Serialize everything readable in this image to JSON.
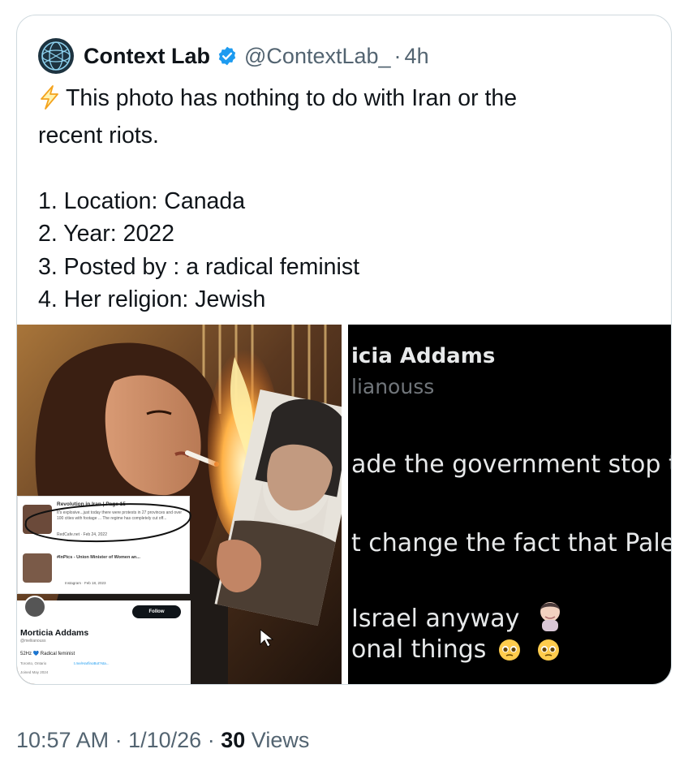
{
  "author": {
    "display_name": "Context Lab",
    "handle": "@ContextLab_",
    "separator": "·",
    "time_ago": "4h",
    "verified": true,
    "avatar_icon": "globe-logo-icon"
  },
  "tweet": {
    "lines": [
      "This photo has nothing to do with Iran or the",
      "recent riots.",
      "",
      "1. Location:  Canada",
      "2. Year:   2022",
      "3. Posted by :  a radical feminist",
      "4. Her religion:  Jewish"
    ],
    "lead_icon": "lightning-bolt-icon"
  },
  "media": {
    "left_inset_list": {
      "item1_title": "Revolution in Iran | Page 15",
      "item1_text": "It's explosive...just today there were protests in 27 provinces and over 100 cities with footage ... The regime has completely cut off...",
      "item1_source": "RedCafe.net · Feb 24, 2022",
      "item2_title": "#InPics - Union Minister of Women an...",
      "item2_source": "Instagram · Feb 18, 2023"
    },
    "left_inset_profile": {
      "follow_label": "Follow",
      "name": "Morticia Addams",
      "handle": "@meliianouss",
      "bio": "52Hz 💙 Radical feminist",
      "location": "Toronto, Ontario",
      "link": "t.me/HarfinoBot?sta...",
      "joined": "Joined May 2024"
    },
    "right_crop": {
      "name": "icia Addams",
      "handle": "lianouss",
      "line1": "ade the government stop th",
      "line2": "t change the fact that Pales",
      "line3": "Israel anyway",
      "line4": "onal things"
    }
  },
  "footer": {
    "time": "10:57 AM",
    "sep1": "·",
    "date": "1/10/26",
    "sep2": "·",
    "views_count": "30",
    "views_label": "Views"
  },
  "colors": {
    "verified_blue": "#1d9bf0",
    "text_primary": "#0f1419",
    "text_secondary": "#536471",
    "border": "#cfd9de"
  }
}
